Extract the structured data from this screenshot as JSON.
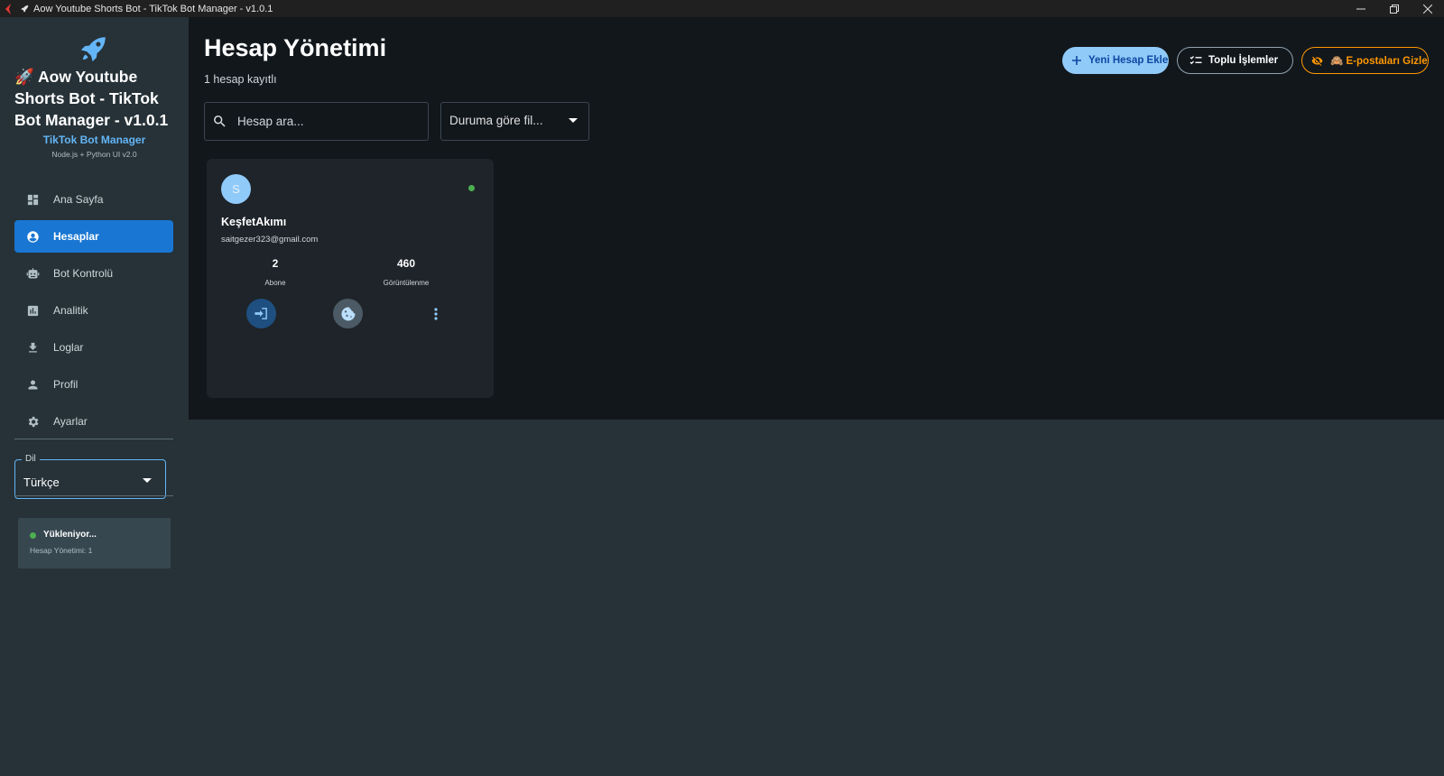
{
  "window": {
    "title": "Aow Youtube Shorts Bot - TikTok Bot Manager - v1.0.1"
  },
  "sidebar": {
    "brand_title": "🚀 Aow Youtube Shorts Bot - TikTok Bot Manager - v1.0.1",
    "brand_subtitle": "TikTok Bot Manager",
    "brand_version": "Node.js + Python UI v2.0",
    "items": [
      {
        "label": "Ana Sayfa",
        "icon": "dashboard-icon",
        "active": false
      },
      {
        "label": "Hesaplar",
        "icon": "account-circle-icon",
        "active": true
      },
      {
        "label": "Bot Kontrolü",
        "icon": "robot-icon",
        "active": false
      },
      {
        "label": "Analitik",
        "icon": "analytics-icon",
        "active": false
      },
      {
        "label": "Loglar",
        "icon": "download-icon",
        "active": false
      },
      {
        "label": "Profil",
        "icon": "person-icon",
        "active": false
      },
      {
        "label": "Ayarlar",
        "icon": "gear-icon",
        "active": false
      }
    ],
    "language": {
      "label": "Dil",
      "value": "Türkçe"
    },
    "status": {
      "title": "Yükleniyor...",
      "line": "Hesap Yönetimi: 1"
    }
  },
  "main": {
    "title": "Hesap Yönetimi",
    "subtitle": "1 hesap kayıtlı",
    "search_placeholder": "Hesap ara...",
    "filter_value": "Duruma göre fil...",
    "buttons": {
      "add": "Yeni Hesap Ekle",
      "bulk": "Toplu İşlemler",
      "hide_emails": "🙈 E-postaları Gizle"
    },
    "accounts": [
      {
        "avatar_letter": "S",
        "name": "KeşfetAkımı",
        "email": "saitgezer323@gmail.com",
        "subscribers": "2",
        "subscribers_label": "Abone",
        "views": "460",
        "views_label": "Görüntülenme",
        "online": true
      }
    ]
  },
  "colors": {
    "accent": "#1976d2",
    "accent_light": "#90caf9",
    "warning": "#ff9800",
    "online": "#4caf50",
    "sidebar_bg": "#263238",
    "content_bg": "#12171c",
    "card_bg": "#1e2429"
  }
}
